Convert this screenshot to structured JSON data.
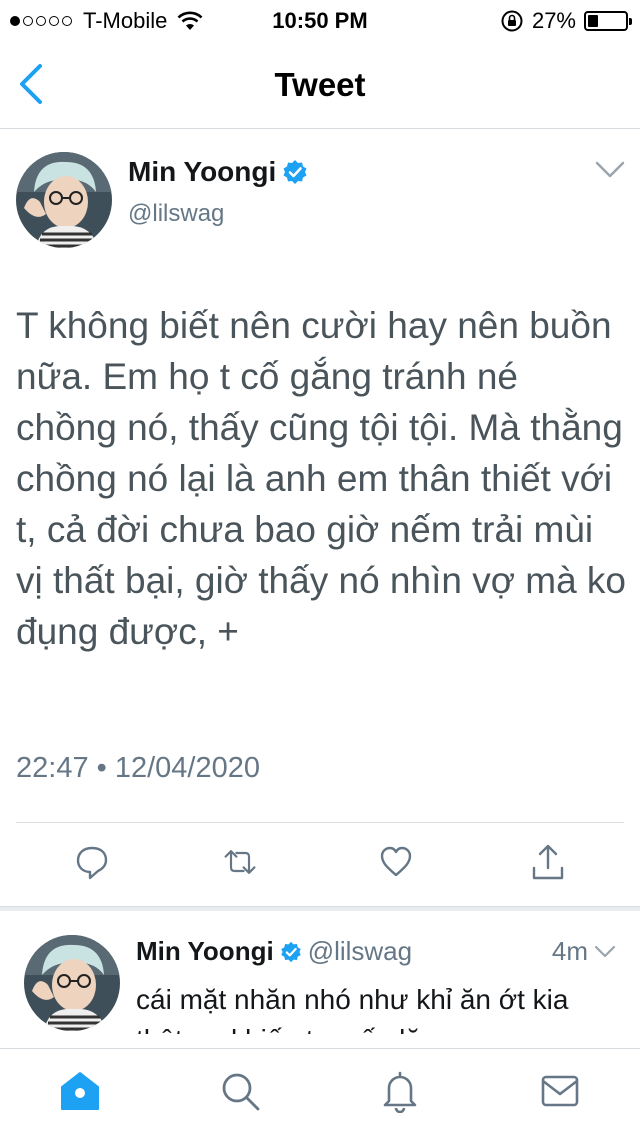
{
  "status_bar": {
    "carrier": "T-Mobile",
    "signal_bars_filled": 1,
    "signal_bars_total": 5,
    "time": "10:50 PM",
    "battery_percent_text": "27%",
    "battery_level": 0.27
  },
  "header": {
    "title": "Tweet",
    "back_icon": "chevron-left-icon"
  },
  "tweet": {
    "author_name": "Min Yoongi",
    "handle": "@lilswag",
    "verified": true,
    "text": "T không biết nên cười hay nên buồn nữa. Em họ t cố gắng tránh né chồng nó, thấy cũng tội tội. Mà thằng chồng nó lại là anh em thân thiết với t, cả đời chưa bao giờ nếm trải mùi vị thất bại, giờ thấy nó nhìn vợ mà ko đụng được, +",
    "timestamp": "22:47 • 12/04/2020",
    "actions": [
      "reply-icon",
      "retweet-icon",
      "like-icon",
      "share-icon"
    ]
  },
  "reply": {
    "author_name": "Min Yoongi",
    "handle": "@lilswag",
    "time_ago": "4m",
    "text": "cái mặt nhăn nhó như khỉ ăn ớt kia thật sự khiến t muốn lăn ra"
  },
  "tab_bar": {
    "tabs": [
      "home-icon",
      "search-icon",
      "notifications-icon",
      "messages-icon"
    ],
    "active": "home-icon"
  },
  "colors": {
    "accent": "#1da1f2",
    "secondary_text": "#657786",
    "divider": "#d8dde1"
  }
}
